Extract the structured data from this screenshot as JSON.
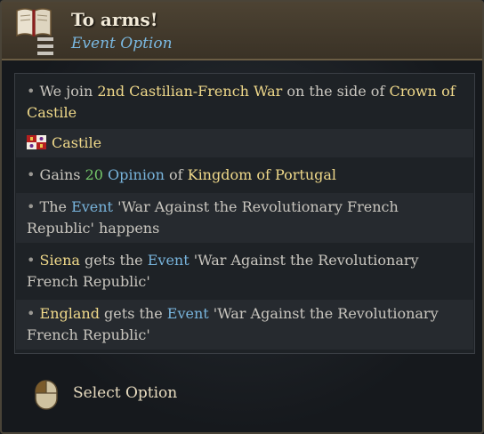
{
  "header": {
    "title": "To arms!",
    "subtitle": "Event Option",
    "icon": "book-icon"
  },
  "effects": [
    {
      "id": "join_war",
      "prefix": "We join ",
      "war": "2nd Castilian-French War",
      "middle": " on the side of ",
      "side": "Crown of Castile"
    },
    {
      "id": "scope",
      "flag_icon": "castile-flag-icon",
      "country": "Castile"
    },
    {
      "id": "opinion",
      "prefix": "Gains ",
      "amount": "20",
      "keyword": "Opinion",
      "of": " of ",
      "target": "Kingdom of Portugal"
    },
    {
      "id": "event_happens",
      "prefix": "The ",
      "keyword": "Event",
      "text": " 'War Against the Revolutionary French Republic' happens"
    },
    {
      "id": "siena_event",
      "country": "Siena",
      "gets": " gets the ",
      "keyword": "Event",
      "text": " 'War Against the Revolutionary French Republic'"
    },
    {
      "id": "england_event",
      "country": "England",
      "gets": " gets the ",
      "keyword": "Event",
      "text": " 'War Against the Revolutionary French Republic'"
    }
  ],
  "footer": {
    "select_label": "Select Option",
    "icon": "mouse-left-click-icon"
  },
  "colors": {
    "highlight_gold": "#f0d98a",
    "keyword_blue": "#78b4dc",
    "positive_green": "#74c66a",
    "body_text": "#c9c6bf"
  }
}
